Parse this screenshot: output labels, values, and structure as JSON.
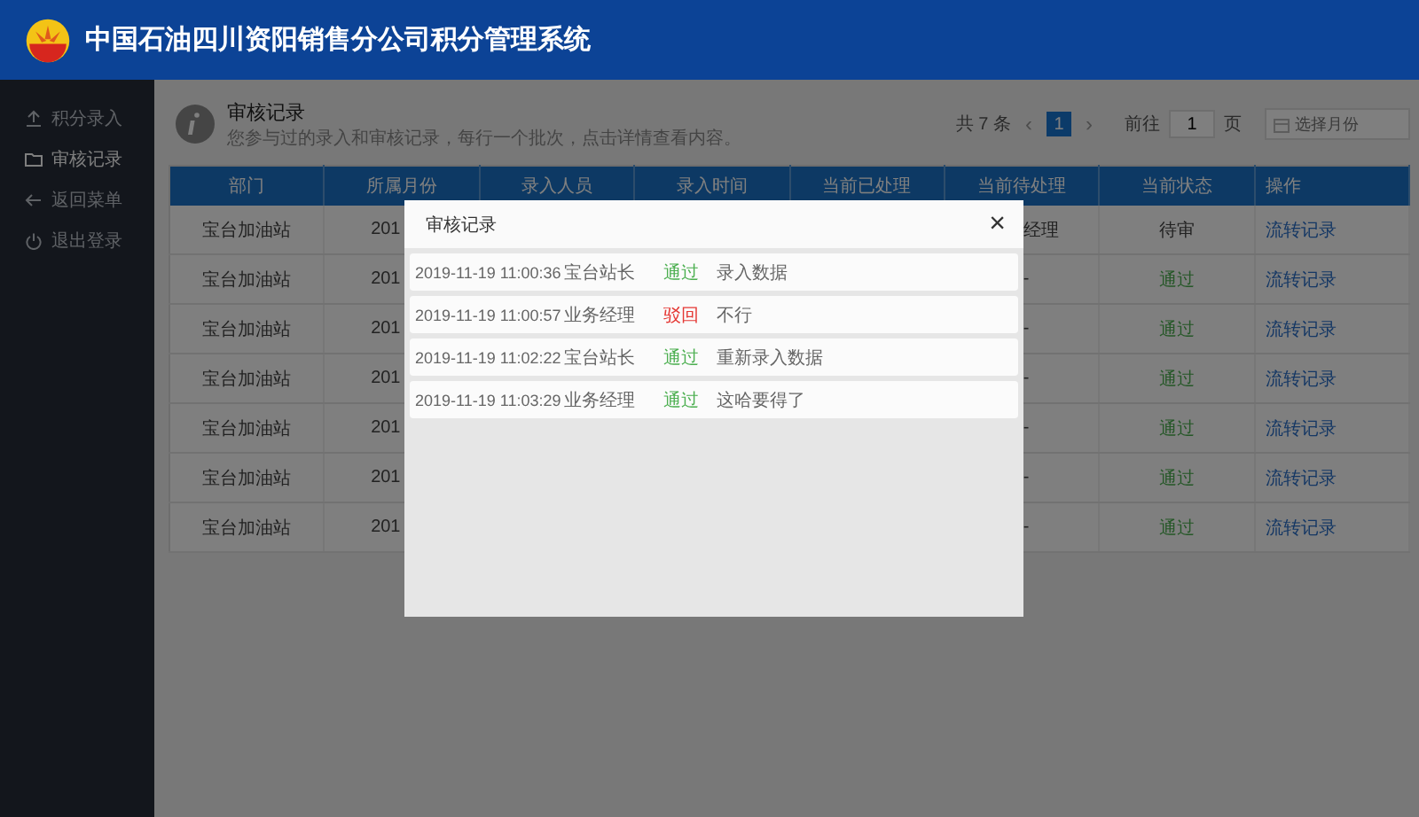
{
  "header": {
    "title": "中国石油四川资阳销售分公司积分管理系统"
  },
  "sidebar": {
    "items": [
      {
        "label": "积分录入",
        "kind": "upload",
        "selected": false
      },
      {
        "label": "审核记录",
        "kind": "folder",
        "selected": true
      },
      {
        "label": "返回菜单",
        "kind": "back",
        "selected": false
      },
      {
        "label": "退出登录",
        "kind": "power",
        "selected": false
      }
    ]
  },
  "page": {
    "title": "审核记录",
    "description": "您参与过的录入和审核记录，每行一个批次，点击详情查看内容。"
  },
  "pagination": {
    "total": "共 7 条",
    "prev": "‹",
    "pages": [
      {
        "label": "1",
        "selected": true
      }
    ],
    "next": "›",
    "goto_label": "前往",
    "goto_value": "1",
    "page_unit": "页",
    "month_placeholder": "选择月份"
  },
  "table": {
    "columns": [
      "部门",
      "所属月份",
      "录入人员",
      "录入时间",
      "当前已处理",
      "当前待处理",
      "当前状态",
      "操作"
    ],
    "rows": [
      {
        "department": "宝台加油站",
        "month": "201",
        "pending_handler": "经理",
        "status": "待审",
        "approved": false,
        "action": "流转记录"
      },
      {
        "department": "宝台加油站",
        "month": "201",
        "pending_handler": "-",
        "status": "通过",
        "approved": true,
        "action": "流转记录"
      },
      {
        "department": "宝台加油站",
        "month": "201",
        "pending_handler": "-",
        "status": "通过",
        "approved": true,
        "action": "流转记录"
      },
      {
        "department": "宝台加油站",
        "month": "201",
        "pending_handler": "-",
        "status": "通过",
        "approved": true,
        "action": "流转记录"
      },
      {
        "department": "宝台加油站",
        "month": "201",
        "pending_handler": "-",
        "status": "通过",
        "approved": true,
        "action": "流转记录"
      },
      {
        "department": "宝台加油站",
        "month": "201",
        "pending_handler": "-",
        "status": "通过",
        "approved": true,
        "action": "流转记录"
      },
      {
        "department": "宝台加油站",
        "month": "201",
        "pending_handler": "-",
        "status": "通过",
        "approved": true,
        "action": "流转记录"
      }
    ]
  },
  "modal": {
    "title": "审核记录",
    "close": "×",
    "records": [
      {
        "time": "2019-11-19 11:00:36",
        "person": "宝台站长",
        "result": "通过",
        "color": "#4caf50",
        "note": "录入数据"
      },
      {
        "time": "2019-11-19 11:00:57",
        "person": "业务经理",
        "result": "驳回",
        "color": "#e53935",
        "note": "不行"
      },
      {
        "time": "2019-11-19 11:02:22",
        "person": "宝台站长",
        "result": "通过",
        "color": "#4caf50",
        "note": "重新录入数据"
      },
      {
        "time": "2019-11-19 11:03:29",
        "person": "业务经理",
        "result": "通过",
        "color": "#4caf50",
        "note": "这哈要得了"
      }
    ]
  }
}
